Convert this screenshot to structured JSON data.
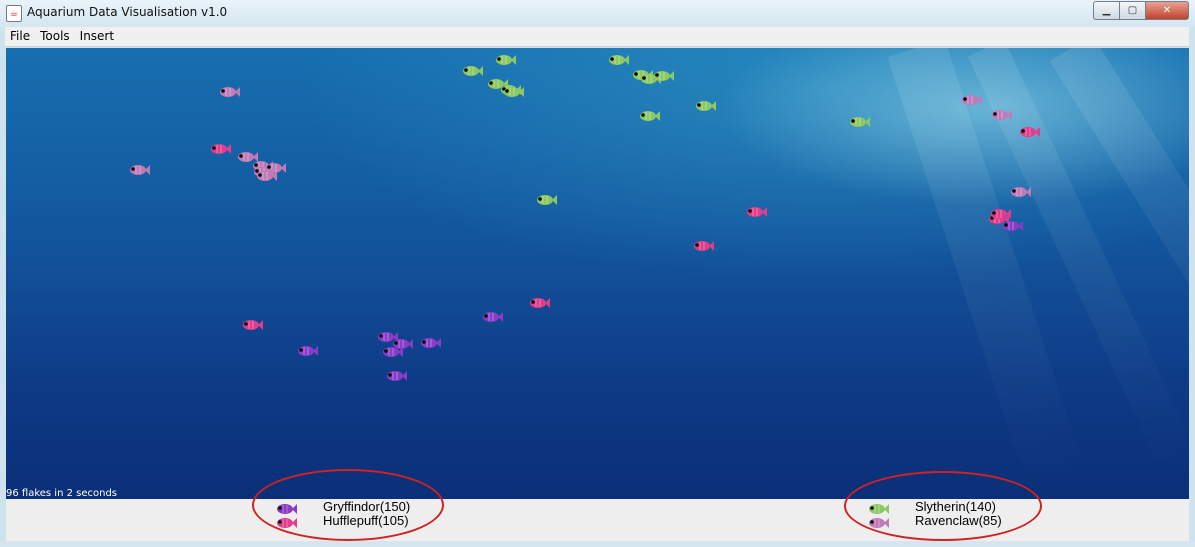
{
  "window": {
    "title": "Aquarium Data Visualisation v1.0"
  },
  "menu": {
    "items": [
      "File",
      "Tools",
      "Insert"
    ]
  },
  "scene": {
    "status": "96 flakes in 2 seconds"
  },
  "colors": {
    "gryffindor": "#8a3cc8",
    "hufflepuff": "#e23c8c",
    "slytherin": "#8cc864",
    "ravenclaw": "#c07ab8",
    "highlight": "#d32020"
  },
  "legend": {
    "entries": [
      {
        "label": "Gryffindor(150)",
        "color": "gryffindor"
      },
      {
        "label": "Hufflepuff(105)",
        "color": "hufflepuff"
      },
      {
        "label": "Slytherin(140)",
        "color": "slytherin"
      },
      {
        "label": "Ravenclaw(85)",
        "color": "ravenclaw"
      }
    ]
  },
  "fish": [
    {
      "house": "slytherin"
    },
    {
      "house": "slytherin"
    },
    {
      "house": "slytherin"
    },
    {
      "house": "slytherin"
    },
    {
      "house": "slytherin"
    },
    {
      "house": "slytherin"
    },
    {
      "house": "slytherin"
    },
    {
      "house": "slytherin"
    },
    {
      "house": "slytherin"
    },
    {
      "house": "slytherin"
    },
    {
      "house": "slytherin"
    },
    {
      "house": "slytherin"
    },
    {
      "house": "slytherin"
    },
    {
      "house": "ravenclaw"
    },
    {
      "house": "ravenclaw"
    },
    {
      "house": "ravenclaw"
    },
    {
      "house": "ravenclaw"
    },
    {
      "house": "ravenclaw"
    },
    {
      "house": "ravenclaw"
    },
    {
      "house": "ravenclaw"
    },
    {
      "house": "ravenclaw"
    },
    {
      "house": "ravenclaw"
    },
    {
      "house": "ravenclaw"
    },
    {
      "house": "hufflepuff"
    },
    {
      "house": "hufflepuff"
    },
    {
      "house": "hufflepuff"
    },
    {
      "house": "hufflepuff"
    },
    {
      "house": "hufflepuff"
    },
    {
      "house": "hufflepuff"
    },
    {
      "house": "hufflepuff"
    },
    {
      "house": "hufflepuff"
    },
    {
      "house": "gryffindor"
    },
    {
      "house": "gryffindor"
    },
    {
      "house": "gryffindor"
    },
    {
      "house": "gryffindor"
    },
    {
      "house": "gryffindor"
    },
    {
      "house": "gryffindor"
    },
    {
      "house": "gryffindor"
    },
    {
      "house": "gryffindor"
    }
  ]
}
